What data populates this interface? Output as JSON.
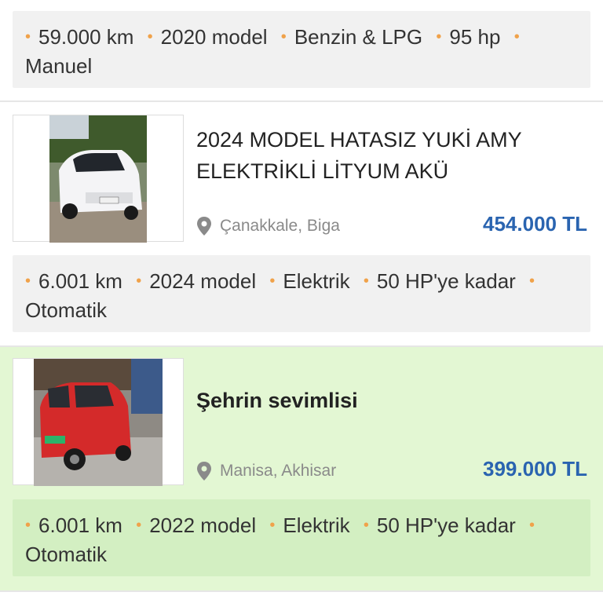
{
  "listing_top": {
    "specs": [
      "59.000 km",
      "2020 model",
      "Benzin & LPG",
      "95 hp",
      "Manuel"
    ]
  },
  "listing_1": {
    "title_line1": "2024 MODEL HATASIZ YUKİ AMY",
    "title_line2": "ELEKTRİKLİ LİTYUM AKÜ",
    "location": "Çanakkale, Biga",
    "price": "454.000 TL",
    "specs": [
      "6.001 km",
      "2024 model",
      "Elektrik",
      "50 HP'ye kadar",
      "Otomatik"
    ]
  },
  "listing_2": {
    "title": "Şehrin sevimlisi",
    "location": "Manisa, Akhisar",
    "price": "399.000 TL",
    "specs": [
      "6.001 km",
      "2022 model",
      "Elektrik",
      "50 HP'ye kadar",
      "Otomatik"
    ]
  },
  "colors": {
    "accent_price": "#2a64b0",
    "bullet": "#f0a24a",
    "highlight_bg": "#e3f7d3"
  },
  "icons": {
    "location": "map-pin-icon"
  }
}
